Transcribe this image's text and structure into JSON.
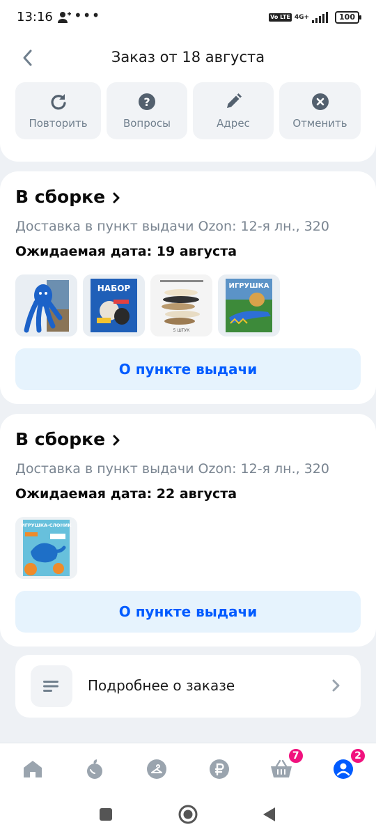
{
  "status_bar": {
    "time": "13:16",
    "dots": "•••",
    "volte": "Vo LTE",
    "network": "4G+",
    "battery": "100"
  },
  "header": {
    "title": "Заказ от 18 августа"
  },
  "actions": [
    {
      "label": "Повторить",
      "icon": "repeat-icon"
    },
    {
      "label": "Вопросы",
      "icon": "question-icon"
    },
    {
      "label": "Адрес",
      "icon": "pencil-icon"
    },
    {
      "label": "Отменить",
      "icon": "cancel-icon"
    }
  ],
  "shipments": [
    {
      "status": "В сборке",
      "delivery": "Доставка в пункт выдачи Ozon: 12-я лн., 320",
      "date": "Ожидаемая дата: 19 августа",
      "products": [
        {
          "name": "blue-octopus-toy"
        },
        {
          "name": "dog-toy-set",
          "text": "НАБОР"
        },
        {
          "name": "plush-toys-pack",
          "text": "5 ШТУК"
        },
        {
          "name": "crocodile-toy",
          "text": "ИГРУШКА"
        }
      ],
      "button": "О пункте выдачи"
    },
    {
      "status": "В сборке",
      "delivery": "Доставка в пункт выдачи Ozon: 12-я лн., 320",
      "date": "Ожидаемая дата: 22 августа",
      "products": [
        {
          "name": "elephant-toy",
          "text": "ИГРУШКА-СЛОНИК"
        }
      ],
      "button": "О пункте выдачи"
    }
  ],
  "details": {
    "label": "Подробнее о заказе"
  },
  "bottom_nav": {
    "items": [
      "home",
      "fresh",
      "hanger",
      "ruble",
      "cart",
      "profile"
    ],
    "cart_badge": "7",
    "profile_badge": "2"
  },
  "colors": {
    "accent": "#005bff",
    "badge": "#f1117e",
    "pickup_bg": "#e6f3fd"
  }
}
